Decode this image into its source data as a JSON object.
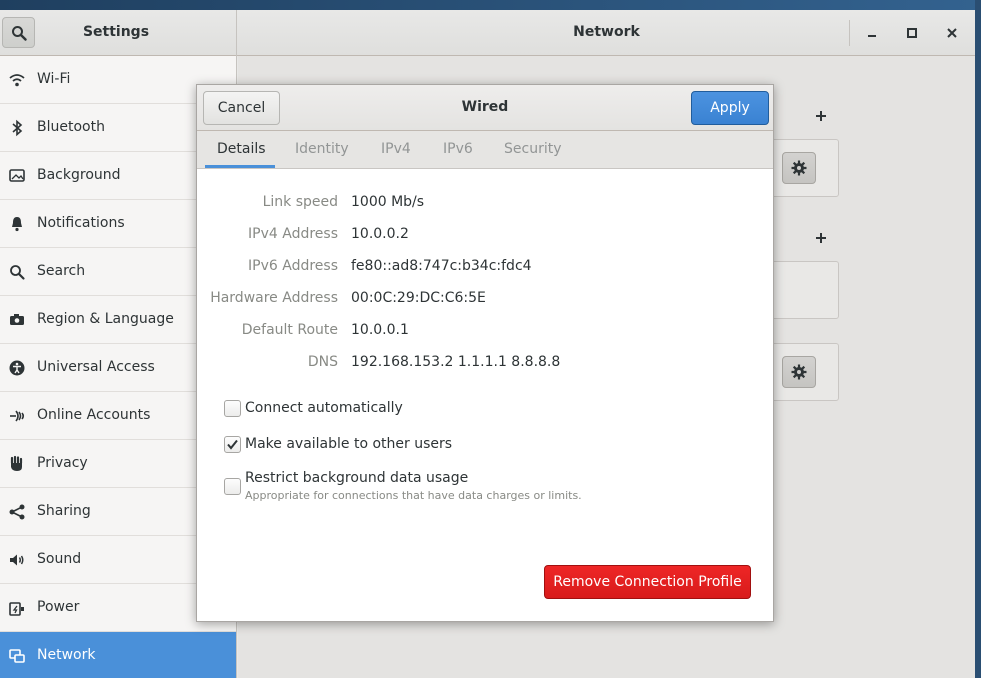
{
  "window": {
    "settings_title": "Settings",
    "panel_title": "Network"
  },
  "sidebar": {
    "items": [
      {
        "label": "Wi-Fi",
        "icon": "wifi-icon"
      },
      {
        "label": "Bluetooth",
        "icon": "bluetooth-icon"
      },
      {
        "label": "Background",
        "icon": "background-icon"
      },
      {
        "label": "Notifications",
        "icon": "bell-icon"
      },
      {
        "label": "Search",
        "icon": "search-icon"
      },
      {
        "label": "Region & Language",
        "icon": "camera-icon"
      },
      {
        "label": "Universal Access",
        "icon": "accessibility-icon"
      },
      {
        "label": "Online Accounts",
        "icon": "online-accounts-icon"
      },
      {
        "label": "Privacy",
        "icon": "hand-icon"
      },
      {
        "label": "Sharing",
        "icon": "share-icon"
      },
      {
        "label": "Sound",
        "icon": "speaker-icon"
      },
      {
        "label": "Power",
        "icon": "power-icon"
      },
      {
        "label": "Network",
        "icon": "network-icon",
        "active": true
      }
    ]
  },
  "dialog": {
    "title": "Wired",
    "cancel_label": "Cancel",
    "apply_label": "Apply",
    "tabs": [
      "Details",
      "Identity",
      "IPv4",
      "IPv6",
      "Security"
    ],
    "active_tab": "Details",
    "details": [
      {
        "label": "Link speed",
        "value": "1000 Mb/s"
      },
      {
        "label": "IPv4 Address",
        "value": "10.0.0.2"
      },
      {
        "label": "IPv6 Address",
        "value": "fe80::ad8:747c:b34c:fdc4"
      },
      {
        "label": "Hardware Address",
        "value": "00:0C:29:DC:C6:5E"
      },
      {
        "label": "Default Route",
        "value": "10.0.0.1"
      },
      {
        "label": "DNS",
        "value": "192.168.153.2 1.1.1.1 8.8.8.8"
      }
    ],
    "options": [
      {
        "label": "Connect automatically",
        "checked": false
      },
      {
        "label": "Make available to other users",
        "checked": true
      },
      {
        "label": "Restrict background data usage",
        "sublabel": "Appropriate for connections that have data charges or limits.",
        "checked": false
      }
    ],
    "remove_label": "Remove Connection Profile"
  },
  "colors": {
    "accent": "#4a90d9",
    "destructive": "#e01b24"
  }
}
